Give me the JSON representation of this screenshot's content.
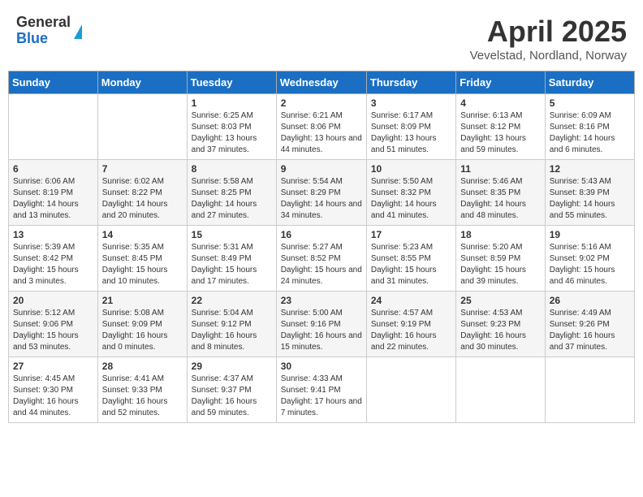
{
  "header": {
    "logo_general": "General",
    "logo_blue": "Blue",
    "month_title": "April 2025",
    "subtitle": "Vevelstad, Nordland, Norway"
  },
  "days_of_week": [
    "Sunday",
    "Monday",
    "Tuesday",
    "Wednesday",
    "Thursday",
    "Friday",
    "Saturday"
  ],
  "weeks": [
    [
      {
        "day": "",
        "info": ""
      },
      {
        "day": "",
        "info": ""
      },
      {
        "day": "1",
        "info": "Sunrise: 6:25 AM\nSunset: 8:03 PM\nDaylight: 13 hours and 37 minutes."
      },
      {
        "day": "2",
        "info": "Sunrise: 6:21 AM\nSunset: 8:06 PM\nDaylight: 13 hours and 44 minutes."
      },
      {
        "day": "3",
        "info": "Sunrise: 6:17 AM\nSunset: 8:09 PM\nDaylight: 13 hours and 51 minutes."
      },
      {
        "day": "4",
        "info": "Sunrise: 6:13 AM\nSunset: 8:12 PM\nDaylight: 13 hours and 59 minutes."
      },
      {
        "day": "5",
        "info": "Sunrise: 6:09 AM\nSunset: 8:16 PM\nDaylight: 14 hours and 6 minutes."
      }
    ],
    [
      {
        "day": "6",
        "info": "Sunrise: 6:06 AM\nSunset: 8:19 PM\nDaylight: 14 hours and 13 minutes."
      },
      {
        "day": "7",
        "info": "Sunrise: 6:02 AM\nSunset: 8:22 PM\nDaylight: 14 hours and 20 minutes."
      },
      {
        "day": "8",
        "info": "Sunrise: 5:58 AM\nSunset: 8:25 PM\nDaylight: 14 hours and 27 minutes."
      },
      {
        "day": "9",
        "info": "Sunrise: 5:54 AM\nSunset: 8:29 PM\nDaylight: 14 hours and 34 minutes."
      },
      {
        "day": "10",
        "info": "Sunrise: 5:50 AM\nSunset: 8:32 PM\nDaylight: 14 hours and 41 minutes."
      },
      {
        "day": "11",
        "info": "Sunrise: 5:46 AM\nSunset: 8:35 PM\nDaylight: 14 hours and 48 minutes."
      },
      {
        "day": "12",
        "info": "Sunrise: 5:43 AM\nSunset: 8:39 PM\nDaylight: 14 hours and 55 minutes."
      }
    ],
    [
      {
        "day": "13",
        "info": "Sunrise: 5:39 AM\nSunset: 8:42 PM\nDaylight: 15 hours and 3 minutes."
      },
      {
        "day": "14",
        "info": "Sunrise: 5:35 AM\nSunset: 8:45 PM\nDaylight: 15 hours and 10 minutes."
      },
      {
        "day": "15",
        "info": "Sunrise: 5:31 AM\nSunset: 8:49 PM\nDaylight: 15 hours and 17 minutes."
      },
      {
        "day": "16",
        "info": "Sunrise: 5:27 AM\nSunset: 8:52 PM\nDaylight: 15 hours and 24 minutes."
      },
      {
        "day": "17",
        "info": "Sunrise: 5:23 AM\nSunset: 8:55 PM\nDaylight: 15 hours and 31 minutes."
      },
      {
        "day": "18",
        "info": "Sunrise: 5:20 AM\nSunset: 8:59 PM\nDaylight: 15 hours and 39 minutes."
      },
      {
        "day": "19",
        "info": "Sunrise: 5:16 AM\nSunset: 9:02 PM\nDaylight: 15 hours and 46 minutes."
      }
    ],
    [
      {
        "day": "20",
        "info": "Sunrise: 5:12 AM\nSunset: 9:06 PM\nDaylight: 15 hours and 53 minutes."
      },
      {
        "day": "21",
        "info": "Sunrise: 5:08 AM\nSunset: 9:09 PM\nDaylight: 16 hours and 0 minutes."
      },
      {
        "day": "22",
        "info": "Sunrise: 5:04 AM\nSunset: 9:12 PM\nDaylight: 16 hours and 8 minutes."
      },
      {
        "day": "23",
        "info": "Sunrise: 5:00 AM\nSunset: 9:16 PM\nDaylight: 16 hours and 15 minutes."
      },
      {
        "day": "24",
        "info": "Sunrise: 4:57 AM\nSunset: 9:19 PM\nDaylight: 16 hours and 22 minutes."
      },
      {
        "day": "25",
        "info": "Sunrise: 4:53 AM\nSunset: 9:23 PM\nDaylight: 16 hours and 30 minutes."
      },
      {
        "day": "26",
        "info": "Sunrise: 4:49 AM\nSunset: 9:26 PM\nDaylight: 16 hours and 37 minutes."
      }
    ],
    [
      {
        "day": "27",
        "info": "Sunrise: 4:45 AM\nSunset: 9:30 PM\nDaylight: 16 hours and 44 minutes."
      },
      {
        "day": "28",
        "info": "Sunrise: 4:41 AM\nSunset: 9:33 PM\nDaylight: 16 hours and 52 minutes."
      },
      {
        "day": "29",
        "info": "Sunrise: 4:37 AM\nSunset: 9:37 PM\nDaylight: 16 hours and 59 minutes."
      },
      {
        "day": "30",
        "info": "Sunrise: 4:33 AM\nSunset: 9:41 PM\nDaylight: 17 hours and 7 minutes."
      },
      {
        "day": "",
        "info": ""
      },
      {
        "day": "",
        "info": ""
      },
      {
        "day": "",
        "info": ""
      }
    ]
  ]
}
